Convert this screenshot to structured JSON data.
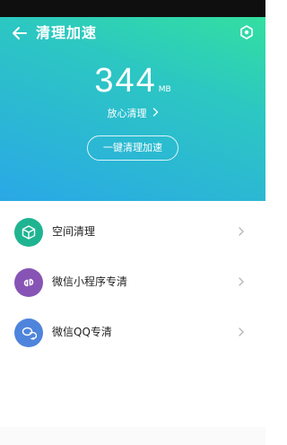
{
  "header": {
    "title": "清理加速",
    "back_icon": "back-arrow-icon",
    "settings_icon": "settings-icon"
  },
  "summary": {
    "size_value": "344",
    "size_unit": "MB",
    "reassure_text": "放心清理",
    "action_label": "一键清理加速"
  },
  "list": {
    "items": [
      {
        "label": "空间清理",
        "icon": "cube-icon",
        "color": "#1fb491"
      },
      {
        "label": "微信小程序专清",
        "icon": "link-icon",
        "color": "#8754b5"
      },
      {
        "label": "微信QQ专清",
        "icon": "chat-icon",
        "color": "#4e84dc"
      }
    ]
  },
  "colors": {
    "gradient_start": "#33dfa0",
    "gradient_end": "#2aa8e6",
    "status_bar": "#0f0f0f"
  }
}
